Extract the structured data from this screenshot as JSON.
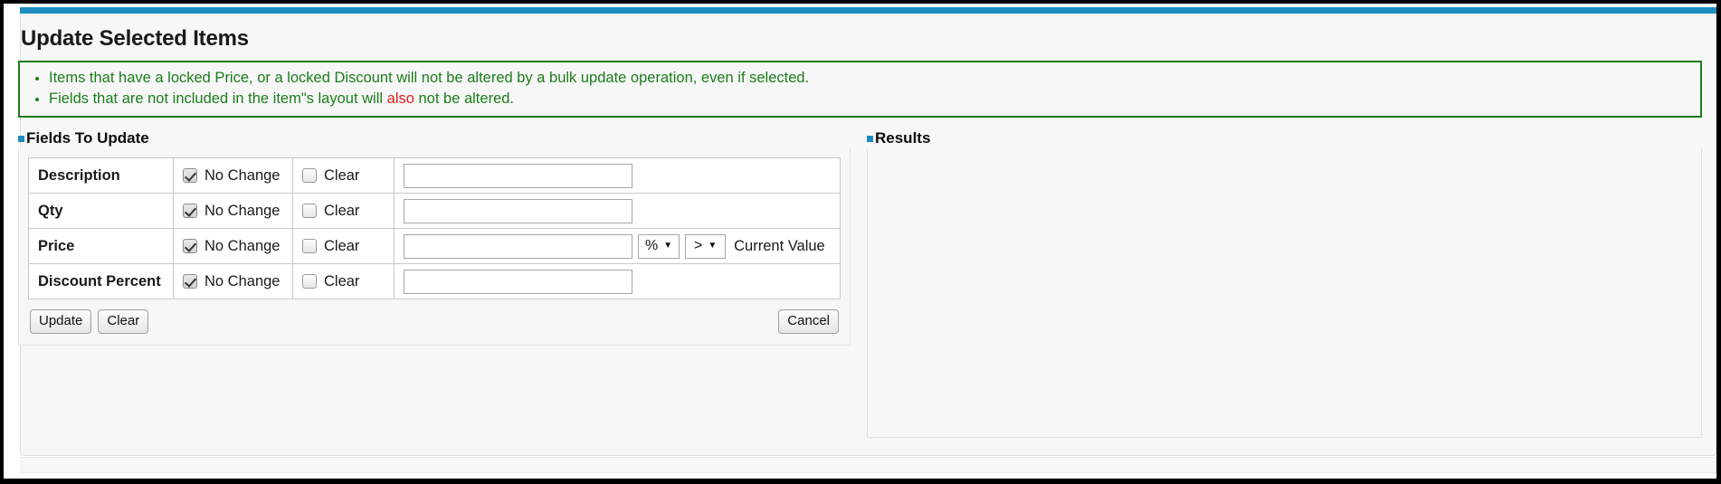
{
  "page": {
    "title": "Update Selected Items",
    "accent_color": "#1b8dbf",
    "notice_border_color": "#1b7d1b",
    "notice_text_color": "#1b7d1b",
    "notice_emphasis_color": "#e02020"
  },
  "notice": {
    "bullets": [
      {
        "before": "Items that have a locked Price, or a locked Discount will not be altered by a bulk update operation, even if selected.",
        "emphasis": "",
        "after": ""
      },
      {
        "before": "Fields that are not included in the item\"s layout will ",
        "emphasis": "also",
        "after": " not be altered."
      }
    ]
  },
  "fields_panel": {
    "legend": "Fields To Update",
    "columns": {
      "no_change_label": "No Change",
      "clear_label": "Clear"
    },
    "rows": [
      {
        "label": "Description",
        "no_change_checked": true,
        "clear_checked": false,
        "value": "",
        "placeholder": "",
        "has_modifiers": false
      },
      {
        "label": "Qty",
        "no_change_checked": true,
        "clear_checked": false,
        "value": "",
        "placeholder": "",
        "has_modifiers": false
      },
      {
        "label": "Price",
        "no_change_checked": true,
        "clear_checked": false,
        "value": "",
        "placeholder": "",
        "has_modifiers": true,
        "unit_select": {
          "selected": "%",
          "options": [
            "%",
            "$"
          ]
        },
        "operator_select": {
          "selected": ">",
          "options": [
            ">",
            "<",
            "="
          ]
        },
        "current_value_label": "Current Value"
      },
      {
        "label": "Discount Percent",
        "no_change_checked": true,
        "clear_checked": false,
        "value": "",
        "placeholder": "",
        "has_modifiers": false
      }
    ]
  },
  "results_panel": {
    "legend": "Results",
    "content": ""
  },
  "buttons": {
    "update": "Update",
    "clear": "Clear",
    "cancel": "Cancel"
  }
}
